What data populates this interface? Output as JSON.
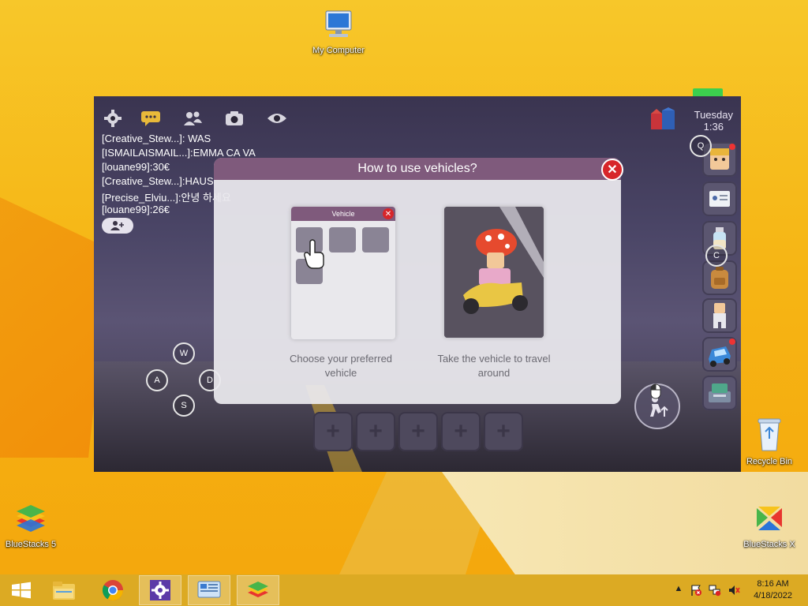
{
  "desktop": {
    "icons": [
      {
        "label": "My Computer"
      },
      {
        "label": "Recycle Bin"
      },
      {
        "label": "BlueStacks 5"
      },
      {
        "label": "BlueStacks X"
      }
    ]
  },
  "emulator": {
    "toolbar": [
      "settings-icon",
      "chat-icon",
      "friends-icon",
      "camera-icon",
      "eye-icon"
    ],
    "chat": [
      "[Creative_Stew...]: WAS",
      "[ISMAILAISMAIL...]:EMMA CA VA",
      "[louane99]:30€",
      "[Creative_Stew...]:HAUS",
      "[Precise_Elviu...]:안녕 하세요",
      "[louane99]:26€"
    ],
    "time_of_day": {
      "day": "Tuesday",
      "time": "1:36"
    },
    "keys": {
      "w": "W",
      "a": "A",
      "s": "S",
      "d": "D",
      "q": "Q",
      "c": "C"
    },
    "dialog": {
      "title": "How to use vehicles?",
      "left_panel": {
        "header": "Vehicle",
        "caption": "Choose your preferred vehicle"
      },
      "right_panel": {
        "caption": "Take the vehicle to travel around"
      }
    },
    "slots": [
      "+",
      "+",
      "+",
      "+",
      "+"
    ]
  },
  "taskbar": {
    "clock": {
      "time": "8:16 AM",
      "date": "4/18/2022"
    }
  }
}
